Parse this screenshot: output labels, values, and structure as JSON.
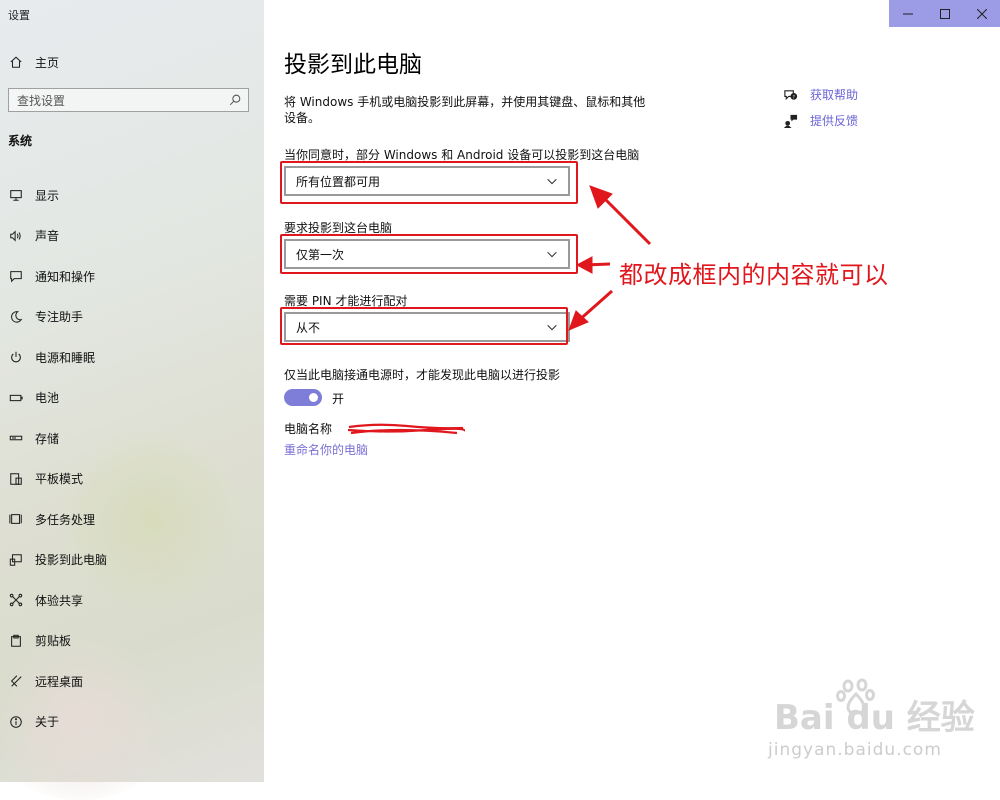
{
  "app": {
    "title": "设置"
  },
  "sidebar": {
    "home_label": "主页",
    "search_placeholder": "查找设置",
    "section_title": "系统",
    "items": [
      {
        "label": "显示",
        "icon": "monitor-icon"
      },
      {
        "label": "声音",
        "icon": "speaker-icon"
      },
      {
        "label": "通知和操作",
        "icon": "notification-icon"
      },
      {
        "label": "专注助手",
        "icon": "moon-icon"
      },
      {
        "label": "电源和睡眠",
        "icon": "power-icon"
      },
      {
        "label": "电池",
        "icon": "battery-icon"
      },
      {
        "label": "存储",
        "icon": "storage-icon"
      },
      {
        "label": "平板模式",
        "icon": "tablet-icon"
      },
      {
        "label": "多任务处理",
        "icon": "multitask-icon"
      },
      {
        "label": "投影到此电脑",
        "icon": "project-icon"
      },
      {
        "label": "体验共享",
        "icon": "share-icon"
      },
      {
        "label": "剪贴板",
        "icon": "clipboard-icon"
      },
      {
        "label": "远程桌面",
        "icon": "remote-icon"
      },
      {
        "label": "关于",
        "icon": "info-icon"
      }
    ]
  },
  "main": {
    "title": "投影到此电脑",
    "description": "将 Windows 手机或电脑投影到此屏幕，并使用其键盘、鼠标和其他设备。",
    "setting1": {
      "label": "当你同意时，部分 Windows 和 Android 设备可以投影到这台电脑",
      "value": "所有位置都可用"
    },
    "setting2": {
      "label": "要求投影到这台电脑",
      "value": "仅第一次"
    },
    "setting3": {
      "label": "需要 PIN 才能进行配对",
      "value": "从不"
    },
    "power_label": "仅当此电脑接通电源时，才能发现此电脑以进行投影",
    "toggle_state": "开",
    "toggle_on": true,
    "pc_name_label": "电脑名称",
    "rename_link": "重命名你的电脑",
    "help_link": "获取帮助",
    "feedback_link": "提供反馈"
  },
  "annotation": {
    "text": "都改成框内的内容就可以",
    "color": "#e0171d"
  },
  "watermark": {
    "brand": "Bai du 经验",
    "url": "jingyan.baidu.com"
  },
  "colors": {
    "accent": "#7e7ed8",
    "link": "#6a64d6",
    "titlebar": "#9b9be6"
  }
}
